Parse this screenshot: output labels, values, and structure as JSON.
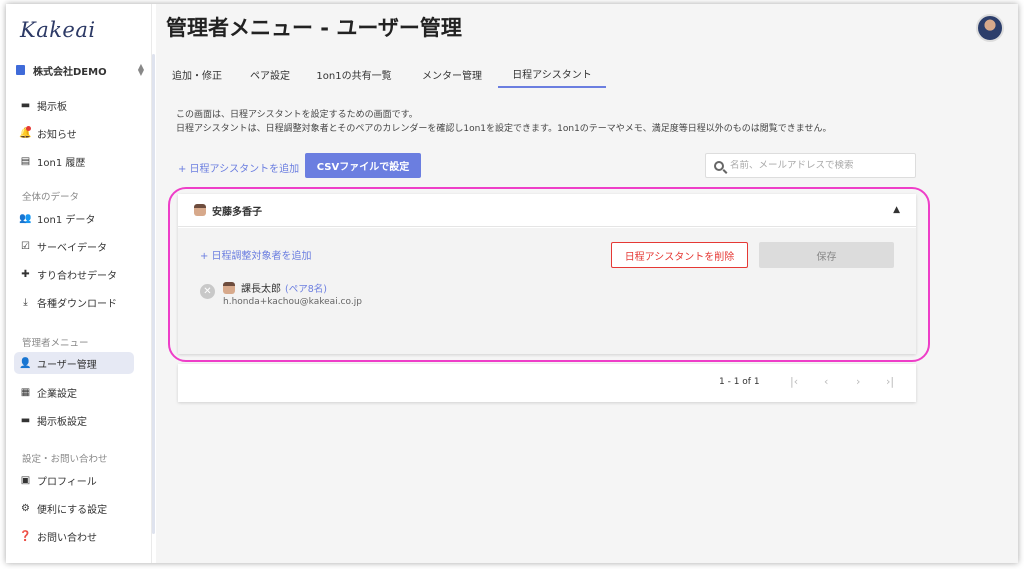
{
  "app": {
    "logo": "Kakeai",
    "company": "株式会社DEMO"
  },
  "sidebar": {
    "items": [
      {
        "label": "掲示板",
        "icon": "board-icon"
      },
      {
        "label": "お知らせ",
        "icon": "bell-icon"
      },
      {
        "label": "1on1 履歴",
        "icon": "history-icon"
      }
    ],
    "section_all": "全体のデータ",
    "all_items": [
      {
        "label": "1on1 データ",
        "icon": "people-icon"
      },
      {
        "label": "サーベイデータ",
        "icon": "survey-icon"
      },
      {
        "label": "すり合わせデータ",
        "icon": "puzzle-icon"
      },
      {
        "label": "各種ダウンロード",
        "icon": "download-icon"
      }
    ],
    "section_admin": "管理者メニュー",
    "admin_items": [
      {
        "label": "ユーザー管理",
        "icon": "user-manage-icon",
        "active": true
      },
      {
        "label": "企業設定",
        "icon": "company-icon"
      },
      {
        "label": "掲示板設定",
        "icon": "board-settings-icon"
      }
    ],
    "section_settings": "設定・お問い合わせ",
    "settings_items": [
      {
        "label": "プロフィール",
        "icon": "profile-icon"
      },
      {
        "label": "便利にする設定",
        "icon": "gear-icon"
      },
      {
        "label": "お問い合わせ",
        "icon": "help-icon"
      }
    ]
  },
  "header": {
    "title": "管理者メニュー - ユーザー管理"
  },
  "tabs": [
    "追加・修正",
    "ペア設定",
    "1on1の共有一覧",
    "メンター管理",
    "日程アシスタント"
  ],
  "active_tab": "日程アシスタント",
  "description": {
    "line1": "この画面は、日程アシスタントを設定するための画面です。",
    "line2": "日程アシスタントは、日程調整対象者とそのペアのカレンダーを確認し1on1を設定できます。1on1のテーマやメモ、満足度等日程以外のものは閲覧できません。"
  },
  "toolbar": {
    "add_assistant": "+ 日程アシスタントを追加",
    "csv_button": "CSVファイルで設定",
    "search_placeholder": "名前、メールアドレスで検索"
  },
  "card": {
    "assistant_name": "安藤多香子",
    "add_target": "+ 日程調整対象者を追加",
    "delete_button": "日程アシスタントを削除",
    "save_button": "保存",
    "target": {
      "name": "課長太郎",
      "pair_count": "(ペア8名)",
      "email": "h.honda+kachou@kakeai.co.jp"
    }
  },
  "pagination": {
    "range": "1 - 1 of 1",
    "first": "|‹",
    "prev": "‹",
    "next": "›",
    "last": "›|"
  },
  "colors": {
    "accent": "#6b7ee0",
    "danger": "#e53935",
    "highlight": "#ee3ec8"
  }
}
